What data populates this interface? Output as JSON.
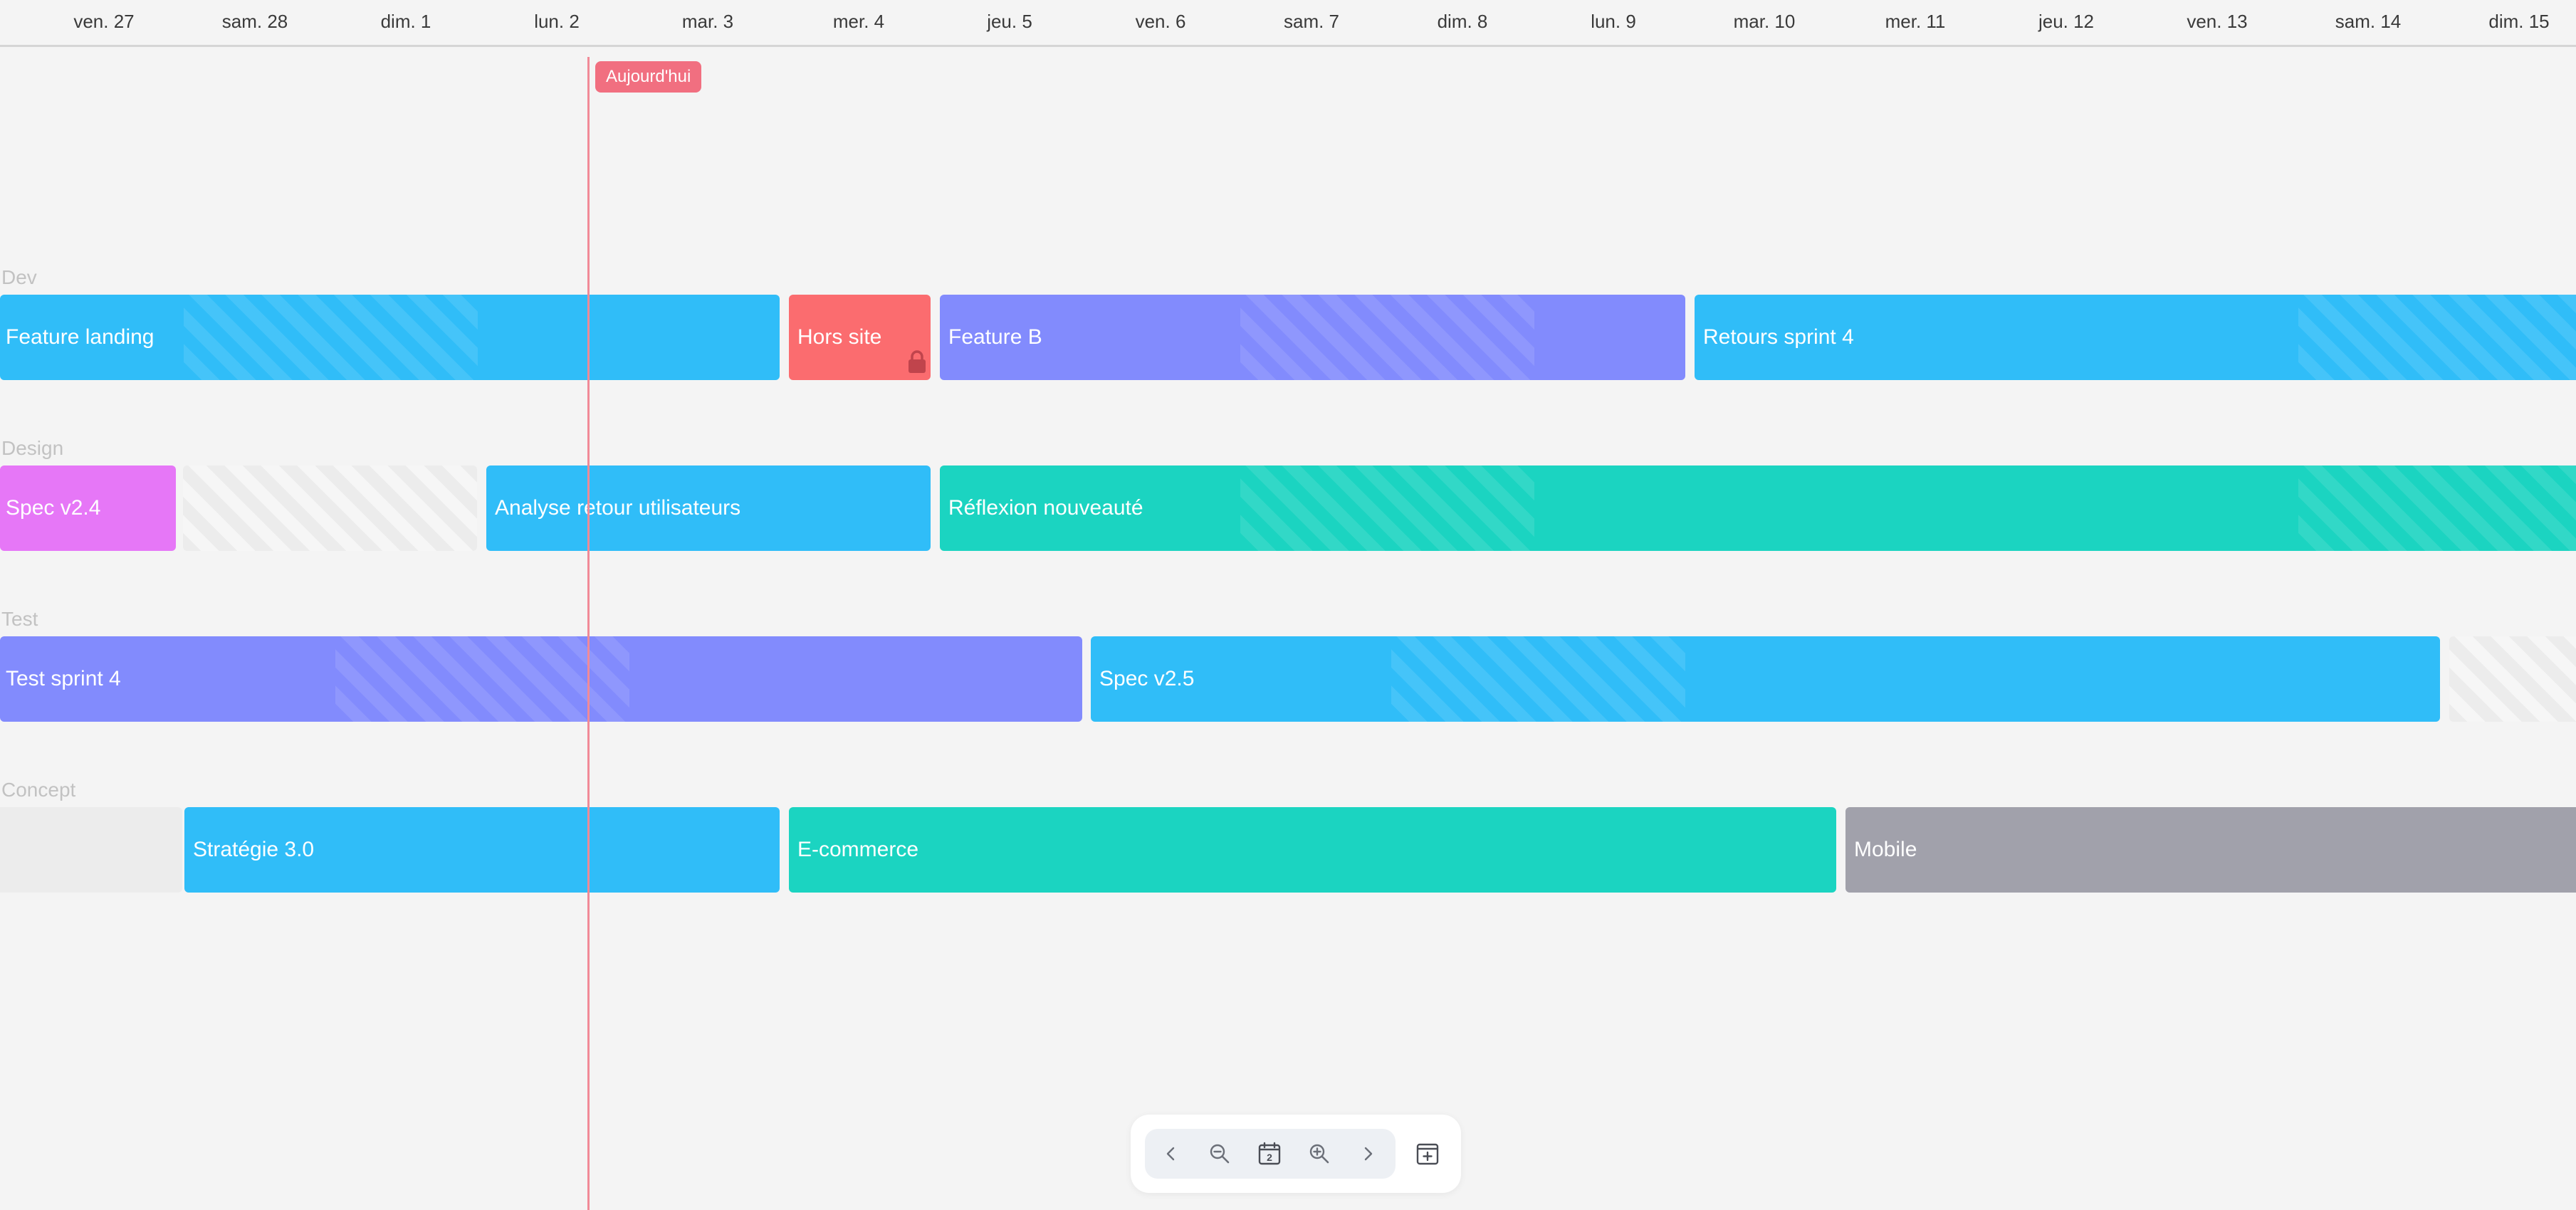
{
  "header": {
    "days": [
      "ven. 27",
      "sam. 28",
      "dim. 1",
      "lun. 2",
      "mar. 3",
      "mer. 4",
      "jeu. 5",
      "ven. 6",
      "sam. 7",
      "dim. 8",
      "lun. 9",
      "mar. 10",
      "mer. 11",
      "jeu. 12",
      "ven. 13",
      "sam. 14",
      "dim. 15"
    ]
  },
  "today": {
    "label": "Aujourd'hui",
    "color": "#f16f80"
  },
  "lanes": [
    {
      "name": "Dev",
      "items": [
        {
          "label": "Feature landing",
          "color": "#30bdf8"
        },
        {
          "label": "Hors site",
          "color": "#fb6c6f",
          "locked": true
        },
        {
          "label": "Feature B",
          "color": "#828bfd"
        },
        {
          "label": "Retours sprint 4",
          "color": "#30bdf8"
        }
      ]
    },
    {
      "name": "Design",
      "items": [
        {
          "label": "Spec v2.4",
          "color": "#e677f7"
        },
        {
          "label": "Analyse retour utilisateurs",
          "color": "#30bdf8"
        },
        {
          "label": "Réflexion nouveauté",
          "color": "#1bd4c1"
        }
      ]
    },
    {
      "name": "Test",
      "items": [
        {
          "label": "Test sprint 4",
          "color": "#828bfd"
        },
        {
          "label": "Spec v2.5",
          "color": "#30bdf8"
        }
      ]
    },
    {
      "name": "Concept",
      "items": [
        {
          "label": "Stratégie 3.0",
          "color": "#30bdf8"
        },
        {
          "label": "E-commerce",
          "color": "#1bd4c1"
        },
        {
          "label": "Mobile",
          "color": "#a1a1ab"
        }
      ]
    }
  ],
  "toolbar": {
    "buttons": [
      {
        "icon": "chevron-left-icon"
      },
      {
        "icon": "zoom-out-icon"
      },
      {
        "icon": "calendar-today-icon",
        "day": "2"
      },
      {
        "icon": "zoom-in-icon"
      },
      {
        "icon": "chevron-right-icon"
      },
      {
        "icon": "calendar-add-icon"
      }
    ]
  }
}
